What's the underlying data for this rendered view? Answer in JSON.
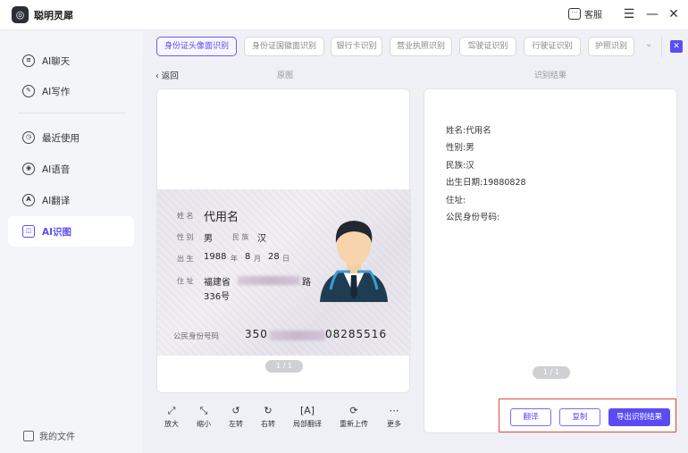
{
  "app": {
    "title": "聪明灵犀",
    "logo_glyph": "◎"
  },
  "titlebar": {
    "service_label": "客服",
    "service_icon": "💬",
    "menu_icon": "☰",
    "minimize_icon": "—",
    "close_icon": "✕"
  },
  "sidebar": {
    "items": [
      {
        "label": "AI聊天",
        "icon": "chat-icon",
        "glyph": "≡"
      },
      {
        "label": "AI写作",
        "icon": "pen-icon",
        "glyph": "✎"
      },
      {
        "label": "最近使用",
        "icon": "clock-icon",
        "glyph": "◷"
      },
      {
        "label": "AI语音",
        "icon": "voice-icon",
        "glyph": "◉"
      },
      {
        "label": "AI翻译",
        "icon": "translate-icon",
        "glyph": "A"
      },
      {
        "label": "AI识图",
        "icon": "scan-icon",
        "glyph": "◫"
      }
    ],
    "active": "AI识图",
    "my_files": "我的文件"
  },
  "tabs": [
    {
      "label": "身份证头像面识别",
      "active": true
    },
    {
      "label": "身份证国徽面识别",
      "active": false
    },
    {
      "label": "银行卡识别",
      "active": false
    },
    {
      "label": "营业执照识别",
      "active": false
    },
    {
      "label": "驾驶证识别",
      "active": false
    },
    {
      "label": "行驶证识别",
      "active": false
    },
    {
      "label": "护照识别",
      "active": false
    }
  ],
  "tabs_more_icon": "⌄",
  "tabs_close_icon": "✕",
  "header": {
    "back": "‹ 返回",
    "original": "原图",
    "result": "识别结果"
  },
  "idcard": {
    "name_label": "姓 名",
    "name": "代用名",
    "sex_label": "性 别",
    "sex": "男",
    "ethnic_label": "民 族",
    "ethnic": "汉",
    "birth_label": "出 生",
    "birth_year": "1988",
    "year_unit": "年",
    "birth_month": "8",
    "month_unit": "月",
    "birth_day": "28",
    "day_unit": "日",
    "address_label": "住 址",
    "address_1": "福建省",
    "address_road": "路",
    "address_2": "336号",
    "id_label": "公民身份号码",
    "id_prefix": "350",
    "id_suffix": "08285516"
  },
  "left_pager": "1 / 1",
  "right_pager": "1 / 1",
  "result": {
    "lines": [
      "姓名:代用名",
      "性别:男",
      "民族:汉",
      "出生日期:19880828",
      "住址:",
      "公民身份号码:"
    ]
  },
  "tools": [
    {
      "label": "放大",
      "icon": "expand-icon",
      "glyph": "⤢"
    },
    {
      "label": "缩小",
      "icon": "shrink-icon",
      "glyph": "⤡"
    },
    {
      "label": "左转",
      "icon": "rotate-left-icon",
      "glyph": "↺"
    },
    {
      "label": "右转",
      "icon": "rotate-right-icon",
      "glyph": "↻"
    },
    {
      "label": "局部翻译",
      "icon": "partial-translate-icon",
      "glyph": "[A]"
    },
    {
      "label": "重新上传",
      "icon": "reupload-icon",
      "glyph": "⟳"
    },
    {
      "label": "更多",
      "icon": "more-icon",
      "glyph": "⋯"
    }
  ],
  "actions": {
    "translate": "翻译",
    "copy": "复制",
    "export": "导出识别结果"
  },
  "colors": {
    "accent": "#5a4cf2",
    "highlight_border": "#e04b3c"
  }
}
